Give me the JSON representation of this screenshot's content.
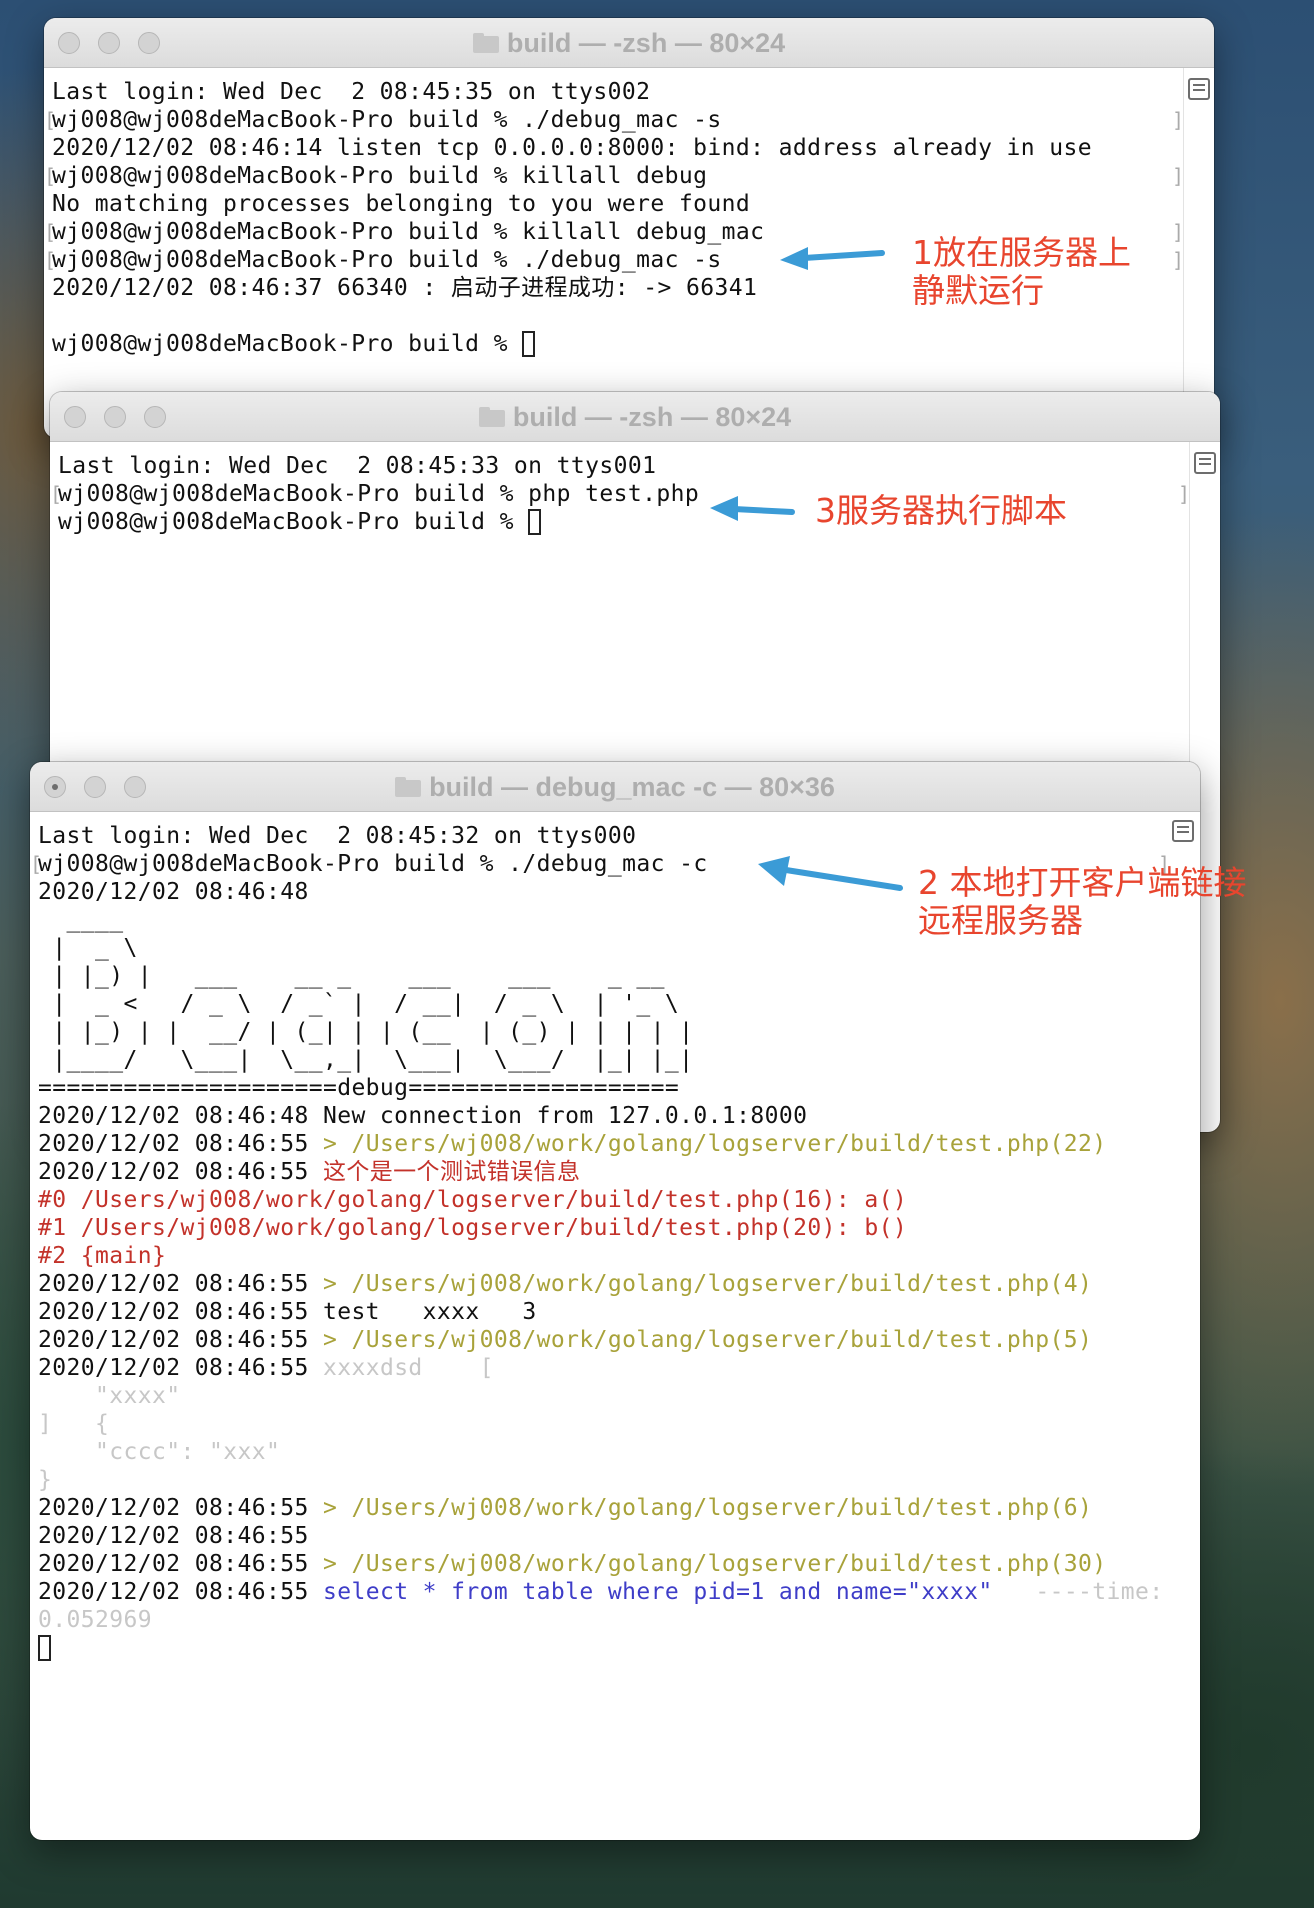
{
  "windows": [
    {
      "title": "build — -zsh — 80×24",
      "lines": [
        {
          "segs": [
            {
              "t": "Last login: Wed Dec  2 08:45:35 on ttys002",
              "c": ""
            }
          ]
        },
        {
          "segs": [
            {
              "t": "wj008@wj008deMacBook-Pro build % ./debug_mac -s",
              "c": ""
            }
          ],
          "mark": true
        },
        {
          "segs": [
            {
              "t": "2020/12/02 08:46:14 listen tcp 0.0.0.0:8000: bind: address already in use",
              "c": ""
            }
          ]
        },
        {
          "segs": [
            {
              "t": "wj008@wj008deMacBook-Pro build % killall debug",
              "c": ""
            }
          ],
          "mark": true
        },
        {
          "segs": [
            {
              "t": "No matching processes belonging to you were found",
              "c": ""
            }
          ]
        },
        {
          "segs": [
            {
              "t": "wj008@wj008deMacBook-Pro build % killall debug_mac",
              "c": ""
            }
          ],
          "mark": true
        },
        {
          "segs": [
            {
              "t": "wj008@wj008deMacBook-Pro build % ./debug_mac -s",
              "c": ""
            }
          ],
          "mark": true
        },
        {
          "segs": [
            {
              "t": "2020/12/02 08:46:37 66340 : 启动子进程成功: -> 66341",
              "c": ""
            }
          ]
        },
        {
          "segs": []
        },
        {
          "segs": [
            {
              "t": "wj008@wj008deMacBook-Pro build % ",
              "c": ""
            }
          ],
          "cursor": true
        }
      ]
    },
    {
      "title": "build — -zsh — 80×24",
      "lines": [
        {
          "segs": [
            {
              "t": "Last login: Wed Dec  2 08:45:33 on ttys001",
              "c": ""
            }
          ]
        },
        {
          "segs": [
            {
              "t": "wj008@wj008deMacBook-Pro build % php test.php",
              "c": ""
            }
          ],
          "mark": true
        },
        {
          "segs": [
            {
              "t": "wj008@wj008deMacBook-Pro build % ",
              "c": ""
            }
          ],
          "cursor": true
        }
      ]
    },
    {
      "title": "build — debug_mac -c — 80×36",
      "lines": [
        {
          "segs": [
            {
              "t": "Last login: Wed Dec  2 08:45:32 on ttys000",
              "c": ""
            }
          ]
        },
        {
          "segs": [
            {
              "t": "wj008@wj008deMacBook-Pro build % ./debug_mac -c",
              "c": ""
            }
          ],
          "mark": true
        },
        {
          "segs": [
            {
              "t": "2020/12/02 08:46:48",
              "c": ""
            }
          ]
        },
        {
          "segs": [
            {
              "t": "  ____",
              "c": ""
            }
          ]
        },
        {
          "segs": [
            {
              "t": " |  _ \\",
              "c": ""
            }
          ]
        },
        {
          "segs": [
            {
              "t": " | |_) |   ___    __ _    ___    ___    _ __",
              "c": ""
            }
          ]
        },
        {
          "segs": [
            {
              "t": " |  _ <   / _ \\  / _` |  / __|  / _ \\  | '_ \\",
              "c": ""
            }
          ]
        },
        {
          "segs": [
            {
              "t": " | |_) | |  __/ | (_| | | (__  | (_) | | | | |",
              "c": ""
            }
          ]
        },
        {
          "segs": [
            {
              "t": " |____/   \\___|  \\__,_|  \\___|  \\___/  |_| |_|",
              "c": ""
            }
          ]
        },
        {
          "segs": [
            {
              "t": "=====================debug===================",
              "c": ""
            }
          ]
        },
        {
          "segs": [
            {
              "t": "2020/12/02 08:46:48 New connection from 127.0.0.1:8000",
              "c": ""
            }
          ]
        },
        {
          "segs": [
            {
              "t": "2020/12/02 08:46:55 ",
              "c": ""
            },
            {
              "t": "> /Users/wj008/work/golang/logserver/build/test.php(22)",
              "c": "path"
            }
          ]
        },
        {
          "segs": [
            {
              "t": "2020/12/02 08:46:55 ",
              "c": ""
            },
            {
              "t": "这个是一个测试错误信息",
              "c": "err"
            }
          ]
        },
        {
          "segs": [
            {
              "t": "#0 /Users/wj008/work/golang/logserver/build/test.php(16): a()",
              "c": "err"
            }
          ]
        },
        {
          "segs": [
            {
              "t": "#1 /Users/wj008/work/golang/logserver/build/test.php(20): b()",
              "c": "err"
            }
          ]
        },
        {
          "segs": [
            {
              "t": "#2 {main}",
              "c": "err"
            }
          ]
        },
        {
          "segs": [
            {
              "t": "2020/12/02 08:46:55 ",
              "c": ""
            },
            {
              "t": "> /Users/wj008/work/golang/logserver/build/test.php(4)",
              "c": "path"
            }
          ]
        },
        {
          "segs": [
            {
              "t": "2020/12/02 08:46:55 test   xxxx   3",
              "c": ""
            }
          ]
        },
        {
          "segs": [
            {
              "t": "2020/12/02 08:46:55 ",
              "c": ""
            },
            {
              "t": "> /Users/wj008/work/golang/logserver/build/test.php(5)",
              "c": "path"
            }
          ]
        },
        {
          "segs": [
            {
              "t": "2020/12/02 08:46:55 ",
              "c": ""
            },
            {
              "t": "xxxxdsd    [",
              "c": "gray"
            }
          ]
        },
        {
          "segs": [
            {
              "t": "    \"xxxx\"",
              "c": "gray"
            }
          ]
        },
        {
          "segs": [
            {
              "t": "]   {",
              "c": "gray"
            }
          ]
        },
        {
          "segs": [
            {
              "t": "    \"cccc\": \"xxx\"",
              "c": "gray"
            }
          ]
        },
        {
          "segs": [
            {
              "t": "}",
              "c": "gray"
            }
          ]
        },
        {
          "segs": [
            {
              "t": "2020/12/02 08:46:55 ",
              "c": ""
            },
            {
              "t": "> /Users/wj008/work/golang/logserver/build/test.php(6)",
              "c": "path"
            }
          ]
        },
        {
          "segs": [
            {
              "t": "2020/12/02 08:46:55",
              "c": ""
            }
          ]
        },
        {
          "segs": [
            {
              "t": "2020/12/02 08:46:55 ",
              "c": ""
            },
            {
              "t": "> /Users/wj008/work/golang/logserver/build/test.php(30)",
              "c": "path"
            }
          ]
        },
        {
          "segs": [
            {
              "t": "2020/12/02 08:46:55 ",
              "c": ""
            },
            {
              "t": "select * from table where pid=1 and name=\"xxxx\"",
              "c": "sql"
            },
            {
              "t": "   ----time:",
              "c": "gray"
            }
          ]
        },
        {
          "segs": [
            {
              "t": "0.052969",
              "c": "gray"
            }
          ]
        },
        {
          "segs": [],
          "cursor": true
        }
      ]
    }
  ],
  "annotations": [
    {
      "text": "1放在服务器上\n静默运行"
    },
    {
      "text": "3服务器执行脚本"
    },
    {
      "text": "2 本地打开客户端链接\n远程服务器"
    }
  ],
  "colors": {
    "annotation": "#e8452e",
    "arrow": "#3b9bd6",
    "path": "#a8a23a",
    "error": "#c3322a",
    "sql": "#3e3dc8",
    "muted": "#c7c7c7"
  }
}
